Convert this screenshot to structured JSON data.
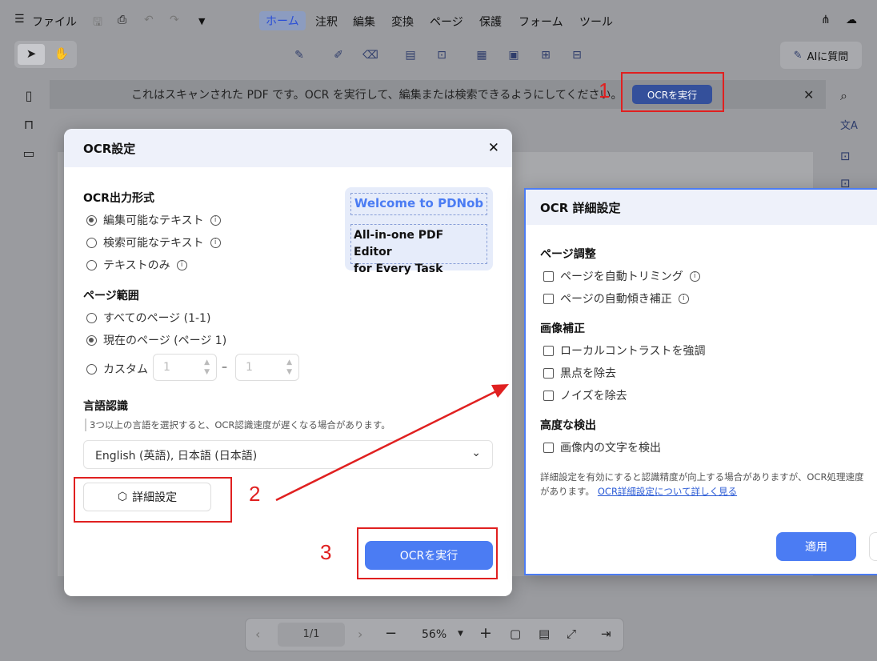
{
  "menu": {
    "file_label": "ファイル",
    "tabs": [
      "ホーム",
      "注釈",
      "編集",
      "変換",
      "ページ",
      "保護",
      "フォーム",
      "ツール"
    ]
  },
  "toolbar": {
    "ai_label": "AIに質問"
  },
  "notice": {
    "text": "これはスキャンされた PDF です。OCR を実行して、編集または検索できるようにしてください。",
    "run_label": "OCRを実行"
  },
  "ocr_dialog": {
    "title": "OCR設定",
    "output_heading": "OCR出力形式",
    "output_options": [
      "編集可能なテキスト",
      "検索可能なテキスト",
      "テキストのみ"
    ],
    "range_heading": "ページ範囲",
    "range_options": [
      "すべてのページ (1-1)",
      "現在のページ (ページ 1)",
      "カスタム"
    ],
    "custom_from": "1",
    "custom_to": "1",
    "custom_sep": "–",
    "lang_heading": "言語認識",
    "lang_note": "3つ以上の言語を選択すると、OCR認識速度が遅くなる場合があります。",
    "lang_value": "English (英語), 日本語 (日本語)",
    "detail_label": "詳細設定",
    "run_label": "OCRを実行",
    "preview_line1": "Welcome to PDNob",
    "preview_line2": "All-in-one PDF Editor",
    "preview_line3": "for Every Task"
  },
  "detail_dialog": {
    "title": "OCR 詳細設定",
    "page_heading": "ページ調整",
    "page_options": [
      "ページを自動トリミング",
      "ページの自動傾き補正"
    ],
    "image_heading": "画像補正",
    "image_options": [
      "ローカルコントラストを強調",
      "黒点を除去",
      "ノイズを除去"
    ],
    "adv_heading": "高度な検出",
    "adv_options": [
      "画像内の文字を検出"
    ],
    "note_line1": "詳細設定を有効にすると認識精度が向上する場合がありますが、OCR処理速度",
    "note_line2": "があります。",
    "note_link": "OCR詳細設定について詳しく見る",
    "apply_label": "適用"
  },
  "annotations": [
    "1",
    "2",
    "3"
  ],
  "pager": {
    "page": "1/1",
    "zoom": "56%"
  }
}
